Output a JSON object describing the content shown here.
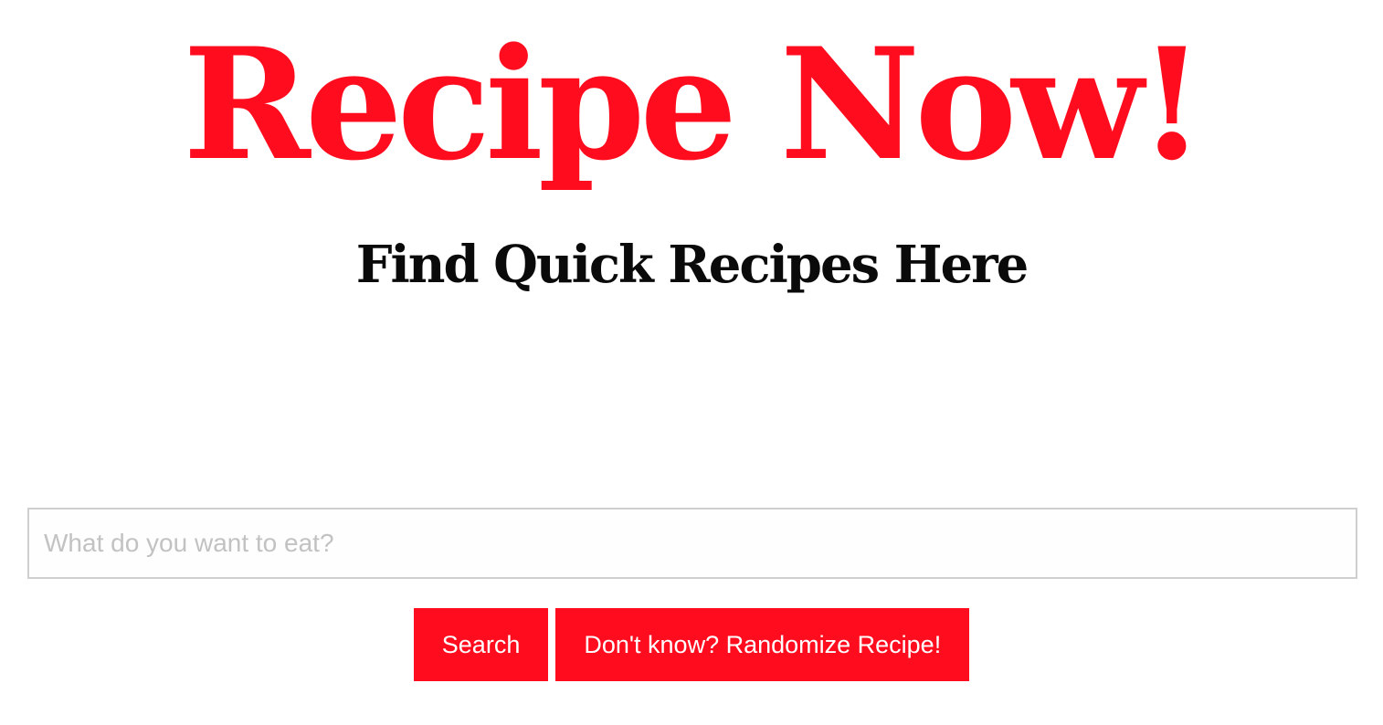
{
  "header": {
    "title": "Recipe Now!",
    "subtitle": "Find Quick Recipes Here"
  },
  "search": {
    "placeholder": "What do you want to eat?",
    "value": ""
  },
  "actions": {
    "search_label": "Search",
    "randomize_label": "Don't know? Randomize Recipe!"
  },
  "colors": {
    "accent": "#ff0d1f",
    "subtitle": "#0a0a0a",
    "input_border": "#cfcfcf",
    "placeholder": "#c2c2c2",
    "background": "#ffffff"
  }
}
